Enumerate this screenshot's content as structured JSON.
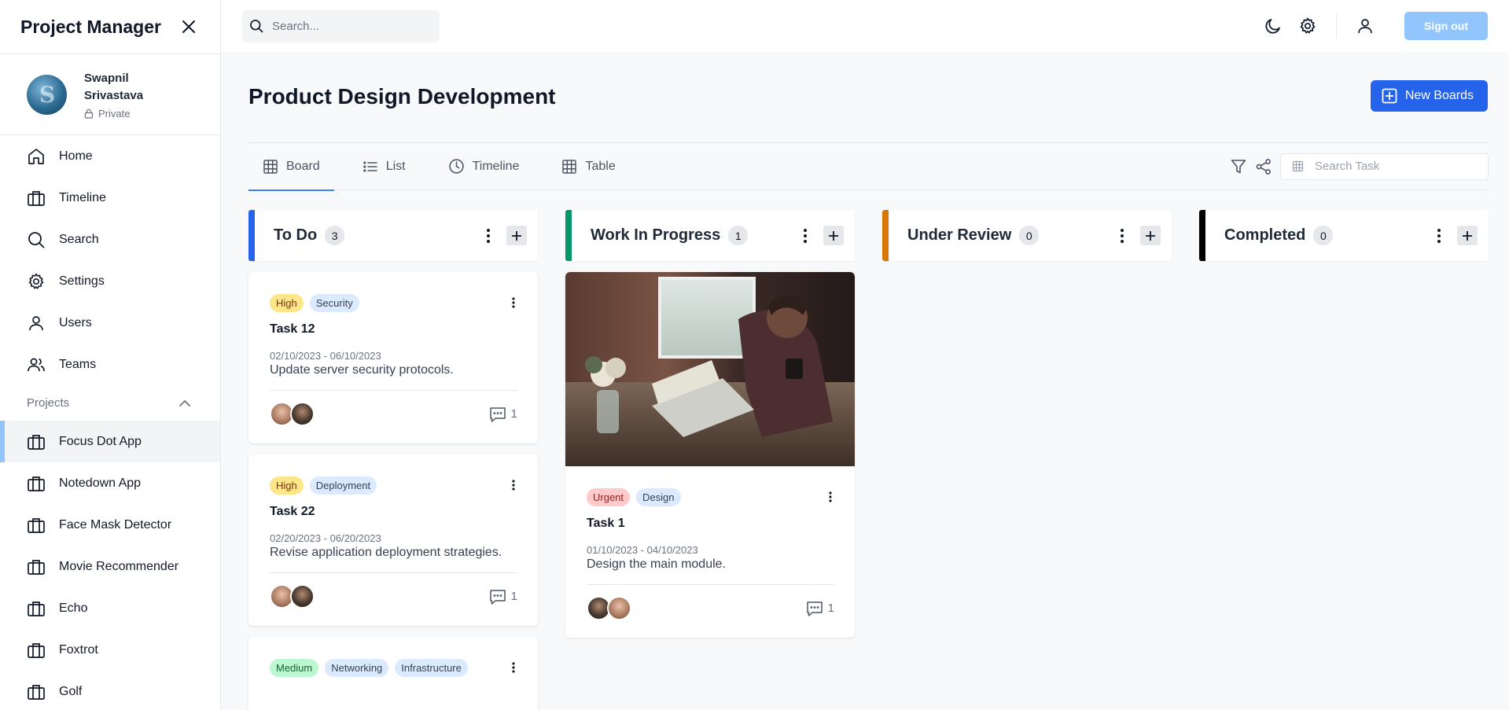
{
  "sidebar": {
    "title": "Project Manager",
    "user": {
      "name": "Swapnil Srivastava",
      "privacy": "Private"
    },
    "nav": [
      {
        "label": "Home",
        "icon": "home-icon"
      },
      {
        "label": "Timeline",
        "icon": "briefcase-icon"
      },
      {
        "label": "Search",
        "icon": "search-icon"
      },
      {
        "label": "Settings",
        "icon": "gear-icon"
      },
      {
        "label": "Users",
        "icon": "user-icon"
      },
      {
        "label": "Teams",
        "icon": "users-icon"
      }
    ],
    "projects_label": "Projects",
    "projects": [
      {
        "label": "Focus Dot App",
        "active": true
      },
      {
        "label": "Notedown App"
      },
      {
        "label": "Face Mask Detector"
      },
      {
        "label": "Movie Recommender"
      },
      {
        "label": "Echo"
      },
      {
        "label": "Foxtrot"
      },
      {
        "label": "Golf"
      }
    ]
  },
  "topbar": {
    "search_placeholder": "Search...",
    "signout_label": "Sign out"
  },
  "main": {
    "title": "Product Design Development",
    "new_board_label": "New Boards",
    "tabs": [
      {
        "label": "Board",
        "icon": "grid-icon",
        "active": true
      },
      {
        "label": "List",
        "icon": "list-icon"
      },
      {
        "label": "Timeline",
        "icon": "clock-icon"
      },
      {
        "label": "Table",
        "icon": "table-icon"
      }
    ],
    "task_search_placeholder": "Search Task"
  },
  "columns": [
    {
      "title": "To Do",
      "count": "3",
      "color": "#2563eb",
      "cards": [
        {
          "tags": [
            {
              "label": "High",
              "kind": "high"
            },
            {
              "label": "Security",
              "kind": "grey"
            }
          ],
          "title": "Task 12",
          "date": "02/10/2023 - 06/10/2023",
          "desc": "Update server security protocols.",
          "comments": "1"
        },
        {
          "tags": [
            {
              "label": "High",
              "kind": "high"
            },
            {
              "label": "Deployment",
              "kind": "grey"
            }
          ],
          "title": "Task 22",
          "date": "02/20/2023 - 06/20/2023",
          "desc": "Revise application deployment strategies.",
          "comments": "1"
        },
        {
          "tags": [
            {
              "label": "Medium",
              "kind": "medium"
            },
            {
              "label": "Networking",
              "kind": "grey"
            },
            {
              "label": "Infrastructure",
              "kind": "grey"
            }
          ]
        }
      ]
    },
    {
      "title": "Work In Progress",
      "count": "1",
      "color": "#059669",
      "cards": [
        {
          "tags": [
            {
              "label": "Urgent",
              "kind": "urgent"
            },
            {
              "label": "Design",
              "kind": "grey"
            }
          ],
          "title": "Task 1",
          "date": "01/10/2023 - 04/10/2023",
          "desc": "Design the main module.",
          "comments": "1"
        }
      ]
    },
    {
      "title": "Under Review",
      "count": "0",
      "color": "#d97706",
      "cards": []
    },
    {
      "title": "Completed",
      "count": "0",
      "color": "#000000",
      "cards": []
    }
  ]
}
